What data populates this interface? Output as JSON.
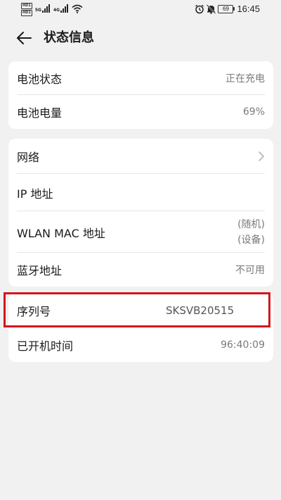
{
  "status_bar": {
    "sim_badges": [
      "HD1",
      "HD2"
    ],
    "network_tags": [
      "5G",
      "4G"
    ],
    "battery_level": "69",
    "time": "16:45"
  },
  "header": {
    "title": "状态信息"
  },
  "battery_card": {
    "rows": [
      {
        "label": "电池状态",
        "value": "正在充电"
      },
      {
        "label": "电池电量",
        "value": "69%"
      }
    ]
  },
  "network_card": {
    "rows": [
      {
        "label": "网络",
        "value": ""
      },
      {
        "label": "IP 地址",
        "value": ""
      },
      {
        "label": "WLAN MAC 地址",
        "value_line1": "(随机)",
        "value_line2": "(设备)"
      },
      {
        "label": "蓝牙地址",
        "value": "不可用"
      }
    ]
  },
  "device_card": {
    "rows": [
      {
        "label": "序列号",
        "value": "SKSVB20515"
      },
      {
        "label": "已开机时间",
        "value": "96:40:09"
      }
    ]
  },
  "colors": {
    "background": "#f1f1f1",
    "card": "#ffffff",
    "highlight": "#d3161d",
    "secondary_text": "#7a7a7a"
  }
}
